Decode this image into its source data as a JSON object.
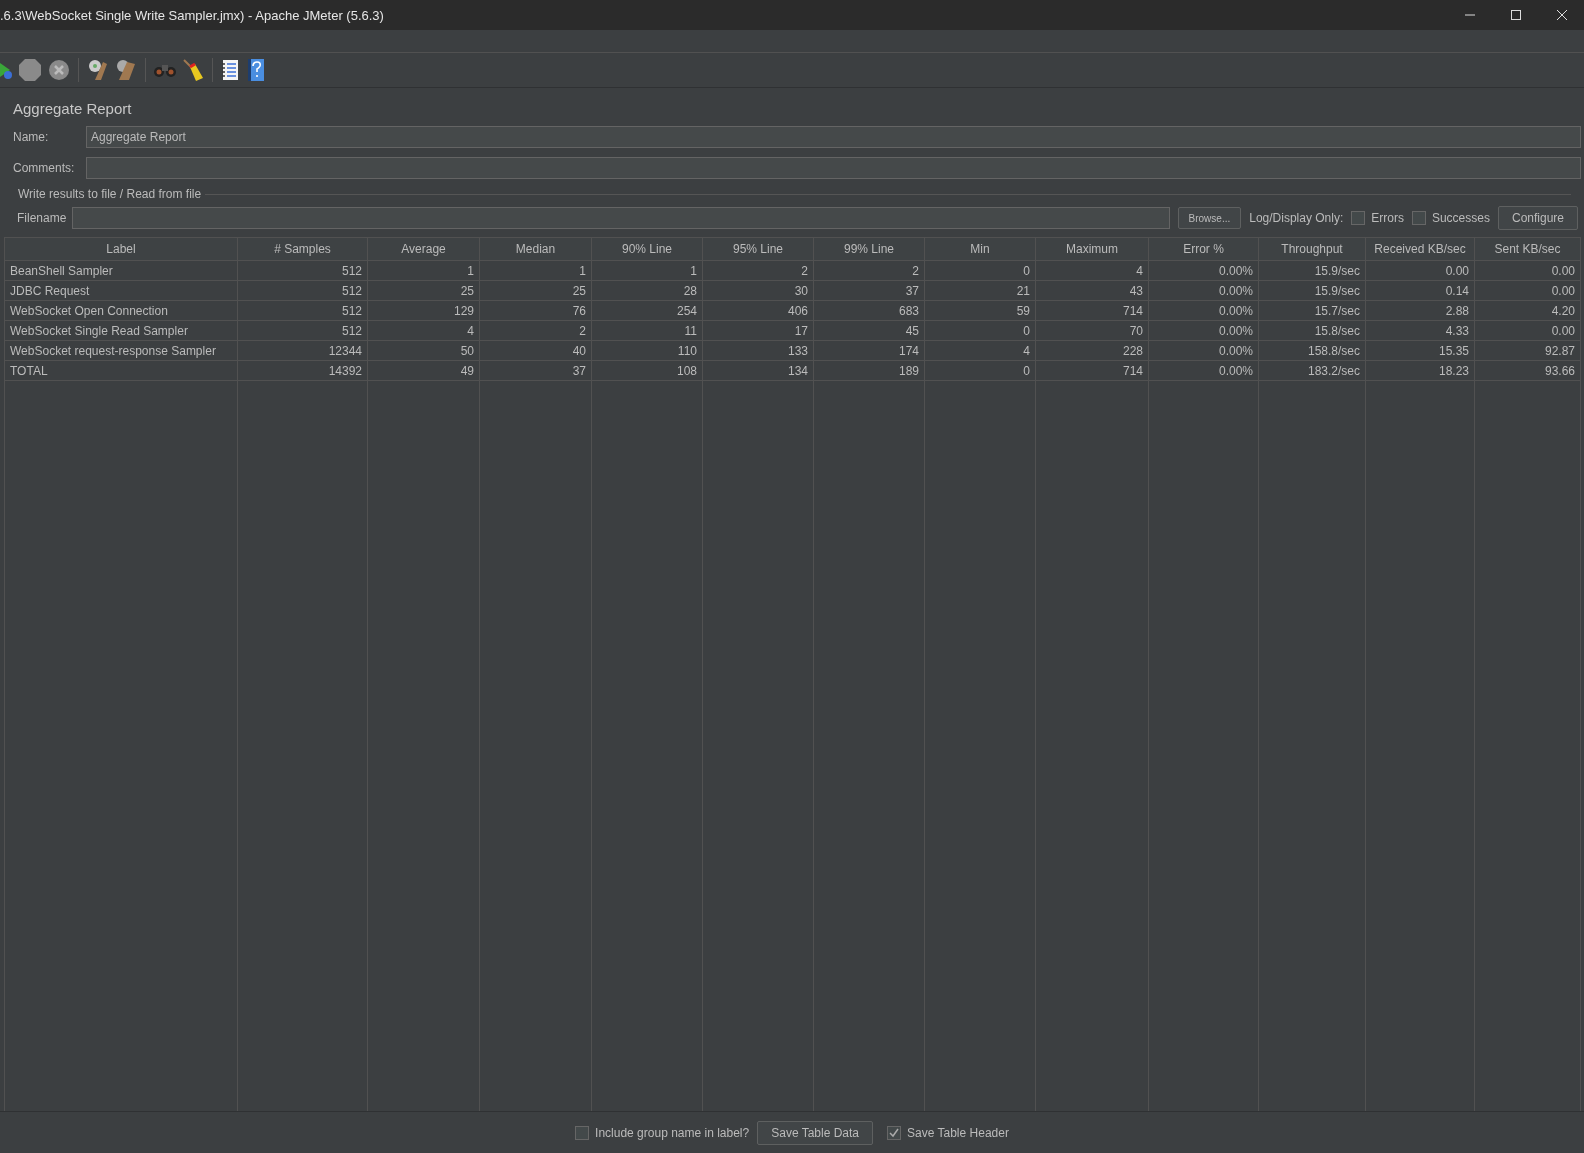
{
  "window": {
    "title": ".6.3\\WebSocket Single Write Sampler.jmx) - Apache JMeter (5.6.3)"
  },
  "panel": {
    "title": "Aggregate Report",
    "name_label": "Name:",
    "name_value": "Aggregate Report",
    "comments_label": "Comments:",
    "file_group_label": "Write results to file / Read from file",
    "filename_label": "Filename",
    "browse_button": "Browse...",
    "log_display_label": "Log/Display Only:",
    "checkboxes": [
      {
        "label": "Errors",
        "checked": false
      },
      {
        "label": "Successes",
        "checked": false
      }
    ],
    "configure_button": "Configure"
  },
  "table": {
    "columns": [
      "Label",
      "# Samples",
      "Average",
      "Median",
      "90% Line",
      "95% Line",
      "99% Line",
      "Min",
      "Maximum",
      "Error %",
      "Throughput",
      "Received KB/sec",
      "Sent KB/sec"
    ],
    "rows": [
      [
        "BeanShell Sampler",
        "512",
        "1",
        "1",
        "1",
        "2",
        "2",
        "0",
        "4",
        "0.00%",
        "15.9/sec",
        "0.00",
        "0.00"
      ],
      [
        "JDBC Request",
        "512",
        "25",
        "25",
        "28",
        "30",
        "37",
        "21",
        "43",
        "0.00%",
        "15.9/sec",
        "0.14",
        "0.00"
      ],
      [
        "WebSocket Open Connection",
        "512",
        "129",
        "76",
        "254",
        "406",
        "683",
        "59",
        "714",
        "0.00%",
        "15.7/sec",
        "2.88",
        "4.20"
      ],
      [
        "WebSocket Single Read Sampler",
        "512",
        "4",
        "2",
        "11",
        "17",
        "45",
        "0",
        "70",
        "0.00%",
        "15.8/sec",
        "4.33",
        "0.00"
      ],
      [
        "WebSocket request-response Sampler",
        "12344",
        "50",
        "40",
        "110",
        "133",
        "174",
        "4",
        "228",
        "0.00%",
        "158.8/sec",
        "15.35",
        "92.87"
      ],
      [
        "TOTAL",
        "14392",
        "49",
        "37",
        "108",
        "134",
        "189",
        "0",
        "714",
        "0.00%",
        "183.2/sec",
        "18.23",
        "93.66"
      ]
    ]
  },
  "footer": {
    "include_group": {
      "label": "Include group name in label?",
      "checked": false
    },
    "save_data_button": "Save Table Data",
    "save_header": {
      "label": "Save Table Header",
      "checked": true
    }
  }
}
